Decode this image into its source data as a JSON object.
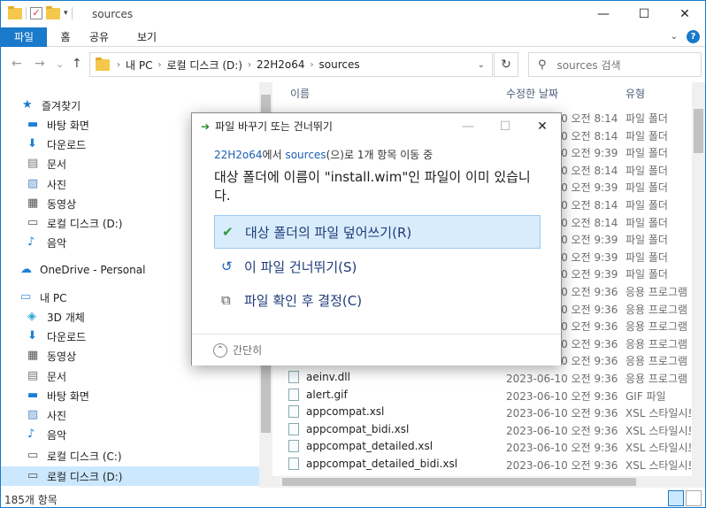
{
  "window": {
    "title": "sources",
    "controls": {
      "minimize": "—",
      "maximize": "☐",
      "close": "✕"
    }
  },
  "ribbon": {
    "tabs": [
      "파일",
      "홈",
      "공유",
      "보기"
    ]
  },
  "nav": {
    "back": "←",
    "forward": "→",
    "recent": "⌄",
    "up": "↑",
    "breadcrumb": [
      "내 PC",
      "로컬 디스크 (D:)",
      "22H2o64",
      "sources"
    ],
    "refresh": "↻",
    "search_placeholder": "sources 검색"
  },
  "sidebar": {
    "items": [
      {
        "label": "즐겨찾기",
        "icon": "star-icon"
      },
      {
        "label": "바탕 화면",
        "icon": "desktop-icon"
      },
      {
        "label": "다운로드",
        "icon": "download-icon"
      },
      {
        "label": "문서",
        "icon": "document-icon"
      },
      {
        "label": "사진",
        "icon": "picture-icon"
      },
      {
        "label": "동영상",
        "icon": "video-icon"
      },
      {
        "label": "로컬 디스크 (D:)",
        "icon": "drive-icon"
      },
      {
        "label": "음악",
        "icon": "music-icon"
      },
      {
        "label": "OneDrive - Personal",
        "icon": "cloud-icon"
      },
      {
        "label": "내 PC",
        "icon": "pc-icon"
      },
      {
        "label": "3D 개체",
        "icon": "cube-icon"
      },
      {
        "label": "다운로드",
        "icon": "download-icon"
      },
      {
        "label": "동영상",
        "icon": "video-icon"
      },
      {
        "label": "문서",
        "icon": "document-icon"
      },
      {
        "label": "바탕 화면",
        "icon": "desktop-icon"
      },
      {
        "label": "사진",
        "icon": "picture-icon"
      },
      {
        "label": "음악",
        "icon": "music-icon"
      },
      {
        "label": "로컬 디스크 (C:)",
        "icon": "drive-icon"
      },
      {
        "label": "로컬 디스크 (D:)",
        "icon": "drive-icon"
      }
    ]
  },
  "list": {
    "headers": {
      "name": "이름",
      "date": "수정한 날짜",
      "type": "유형"
    },
    "rows": [
      {
        "name": "",
        "date": "2023-06-10 오전 8:14",
        "type": "파일 폴더"
      },
      {
        "name": "",
        "date": "2023-06-10 오전 8:14",
        "type": "파일 폴더"
      },
      {
        "name": "",
        "date": "2023-06-10 오전 9:39",
        "type": "파일 폴더"
      },
      {
        "name": "",
        "date": "2023-06-10 오전 8:14",
        "type": "파일 폴더"
      },
      {
        "name": "",
        "date": "2023-06-10 오전 9:39",
        "type": "파일 폴더"
      },
      {
        "name": "",
        "date": "2023-06-10 오전 8:14",
        "type": "파일 폴더"
      },
      {
        "name": "",
        "date": "2023-06-10 오전 8:14",
        "type": "파일 폴더"
      },
      {
        "name": "",
        "date": "2023-06-10 오전 9:39",
        "type": "파일 폴더"
      },
      {
        "name": "",
        "date": "2023-06-10 오전 9:39",
        "type": "파일 폴더"
      },
      {
        "name": "",
        "date": "2023-06-10 오전 9:39",
        "type": "파일 폴더"
      },
      {
        "name": "",
        "date": "2023-06-10 오전 9:36",
        "type": "응용 프로그램"
      },
      {
        "name": "",
        "date": "2023-06-10 오전 9:36",
        "type": "응용 프로그램"
      },
      {
        "name": "",
        "date": "2023-06-10 오전 9:36",
        "type": "응용 프로그램"
      },
      {
        "name": "",
        "date": "2023-06-10 오전 9:36",
        "type": "응용 프로그램"
      },
      {
        "name": "",
        "date": "2023-06-10 오전 9:36",
        "type": "응용 프로그램"
      },
      {
        "name": "aeinv.dll",
        "date": "2023-06-10 오전 9:36",
        "type": "응용 프로그램"
      },
      {
        "name": "alert.gif",
        "date": "2023-06-10 오전 9:36",
        "type": "GIF 파일"
      },
      {
        "name": "appcompat.xsl",
        "date": "2023-06-10 오전 9:36",
        "type": "XSL 스타일시트"
      },
      {
        "name": "appcompat_bidi.xsl",
        "date": "2023-06-10 오전 9:36",
        "type": "XSL 스타일시트"
      },
      {
        "name": "appcompat_detailed.xsl",
        "date": "2023-06-10 오전 9:36",
        "type": "XSL 스타일시트"
      },
      {
        "name": "appcompat_detailed_bidi.xsl",
        "date": "2023-06-10 오전 9:36",
        "type": "XSL 스타일시트"
      }
    ]
  },
  "status": {
    "count": "185개 항목"
  },
  "dialog": {
    "title": "파일 바꾸기 또는 건너뛰기",
    "source": "22H2o64",
    "sub_mid": "에서 ",
    "dest": "sources",
    "sub_end": "(으)로 1개 항목 이동 중",
    "heading": "대상 폴더에 이름이 \"install.wim\"인 파일이 이미 있습니다.",
    "options": [
      {
        "label": "대상 폴더의 파일 덮어쓰기(R)",
        "icon": "checkmark-icon"
      },
      {
        "label": "이 파일 건너뛰기(S)",
        "icon": "skip-arrow-icon"
      },
      {
        "label": "파일 확인 후 결정(C)",
        "icon": "compare-files-icon"
      }
    ],
    "footer": "간단히"
  }
}
